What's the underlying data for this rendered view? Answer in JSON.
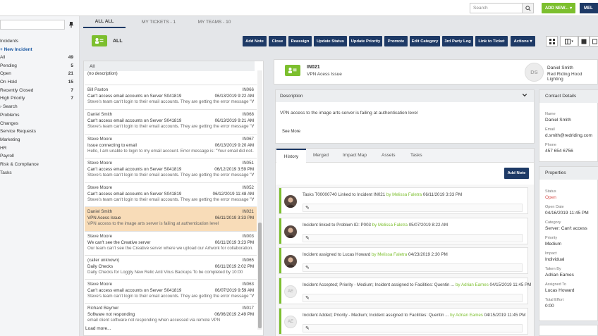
{
  "topbar": {
    "search_placeholder": "Search",
    "add_new": "ADD NEW...",
    "user": "MEL"
  },
  "sidebar": {
    "items": [
      {
        "label": "Incidents",
        "count": ""
      },
      {
        "label": "New Incident",
        "count": ""
      },
      {
        "label": "All",
        "count": "49"
      },
      {
        "label": "Pending",
        "count": "5"
      },
      {
        "label": "Open",
        "count": "21"
      },
      {
        "label": "On Hold",
        "count": "15"
      },
      {
        "label": "Recently Closed",
        "count": "7"
      },
      {
        "label": "High Priority",
        "count": "7"
      },
      {
        "label": "Search",
        "count": ""
      },
      {
        "label": "Problems",
        "count": ""
      },
      {
        "label": "Changes",
        "count": ""
      },
      {
        "label": "Service Requests",
        "count": ""
      },
      {
        "label": "Marketing",
        "count": ""
      },
      {
        "label": "HR",
        "count": ""
      },
      {
        "label": "Payroll",
        "count": ""
      },
      {
        "label": "Risk & Compliance",
        "count": ""
      },
      {
        "label": "Tasks",
        "count": ""
      }
    ]
  },
  "tabs": {
    "all": "ALL ALL",
    "my_tickets": "MY TICKETS - 1",
    "my_teams": "MY TEAMS - 10"
  },
  "header": {
    "title": "ALL"
  },
  "actions": [
    "Add Note",
    "Close",
    "Reassign",
    "Update Status",
    "Update Priority",
    "Promote",
    "Edit Category",
    "3rd Party Log",
    "Link to Ticket",
    "Actions"
  ],
  "list": {
    "heading": "All",
    "load_more": "Load more...",
    "rows": [
      {
        "name": "(no subject)",
        "id": "",
        "subject": "(no description)",
        "date": "",
        "preview": ""
      },
      {
        "name": "Bill Paxton",
        "id": "IN066",
        "subject": "Can't access email accounts on Server S041819",
        "date": "06/13/2019 9:22 AM",
        "preview": "Steve's team can't login to their email accounts. They are getting the error message \"We"
      },
      {
        "name": "Daniel Smith",
        "id": "IN068",
        "subject": "Can't access email accounts on Server S041819",
        "date": "06/13/2019 9:21 AM",
        "preview": "Steve's team can't login to their email accounts. They are getting the error message \"We"
      },
      {
        "name": "Steve Moore",
        "id": "IN067",
        "subject": "Issue connecting to email",
        "date": "06/13/2019 9:20 AM",
        "preview": "Hello,  I am unable to login to my email account. Error message is: \"Your email did not..."
      },
      {
        "name": "Steve Moore",
        "id": "IN051",
        "subject": "Can't access email accounts on Server S041819",
        "date": "06/12/2019 3:59 PM",
        "preview": "Steve's team can't login to their email accounts. They are getting the error message \"We"
      },
      {
        "name": "Steve Moore",
        "id": "IN052",
        "subject": "Can't access email accounts on Server S041819",
        "date": "06/12/2019 11:48 AM",
        "preview": "Steve's team can't login to their email accounts. They are getting the error message \"We"
      },
      {
        "name": "Daniel Smith",
        "id": "IN021",
        "subject": "VPN Acess Issue",
        "date": "06/11/2019 3:33 PM",
        "preview": "VPN access to the image arts server is failing at authentication level"
      },
      {
        "name": "Steve Moore",
        "id": "IN003",
        "subject": "We can't see the Creative server",
        "date": "06/11/2019 3:23 PM",
        "preview": "Our team can't see the Creative server where we upload our Artwork for collaboration. ..."
      },
      {
        "name": "(caller unknown)",
        "id": "IN065",
        "subject": "Daily Checks",
        "date": "06/11/2019 2:02 PM",
        "preview": "Daily Checks for  Loggly New Relic Anti Virus Backups  To be completed by 10:00"
      },
      {
        "name": "Steve Moore",
        "id": "IN063",
        "subject": "Can't access email accounts on Server S041819",
        "date": "06/07/2019 9:59 AM",
        "preview": "Steve's team can't login to their email accounts. They are getting the error message \"We"
      },
      {
        "name": "Richard Beymer",
        "id": "IN017",
        "subject": "Software not responding",
        "date": "06/06/2019 2:49 PM",
        "preview": "email client software not responding when accessed via remote VPN"
      }
    ]
  },
  "detail": {
    "id": "IN021",
    "subject": "VPN Acess Issue",
    "avatar_initials": "DS",
    "requester": "Daniel Smith",
    "org": "Red Riding Hood Lighting",
    "description_title": "Description",
    "description": "VPN access to the image arts server is failing at authentication level",
    "see_more": "See More",
    "tabs": [
      "History",
      "Merged",
      "Impact Map",
      "Assets",
      "Tasks"
    ],
    "add_note": "Add Note",
    "history": [
      {
        "text": "Tasks T00000740 Linked to Incident IN021",
        "by": "by Melissa Faletra",
        "date": "06/11/2019 3:33 PM",
        "avatar": "photo",
        "bar": "#7cbf2e"
      },
      {
        "text": "Incident linked to Problem ID: P003",
        "by": "by Melissa Faletra",
        "date": "05/07/2019 8:22 AM",
        "avatar": "photo",
        "bar": "#7cbf2e"
      },
      {
        "text": "Incident assigned to Lucas Howard",
        "by": "by Melissa Faletra",
        "date": "04/23/2019 2:30 PM",
        "avatar": "photo",
        "bar": "#7cbf2e"
      },
      {
        "text": "Incident Accepted; Priority - Medium; Incident assigned to Facilities: Quentin ...",
        "by": "by Adrian Eames",
        "date": "04/15/2019 11:45 PM",
        "avatar": "AE",
        "bar": "#7cbf2e"
      },
      {
        "text": "Incident Added; Priority - Medium; Incident assigned to Facilities: Quentin ...",
        "by": "by Adrian Eames",
        "date": "04/15/2019 11:45 PM",
        "avatar": "AE",
        "bar": "#7cbf2e"
      }
    ]
  },
  "contact": {
    "title": "Contact Details",
    "name_label": "Name",
    "name": "Daniel Smith",
    "email_label": "Email",
    "email": "d.smith@redriding.com",
    "phone_label": "Phone",
    "phone": "457 654 6756"
  },
  "properties": {
    "title": "Properties",
    "status_label": "Status",
    "status": "Open",
    "open_date_label": "Open Date",
    "open_date": "04/16/2019 11:45 PM",
    "category_label": "Category",
    "category": "Server: Can't access",
    "priority_label": "Priority",
    "priority": "Medium",
    "impact_label": "Impact",
    "impact": "Individual",
    "taken_by_label": "Taken By",
    "taken_by": "Adrian Eames",
    "assigned_label": "Assigned To",
    "assigned": "Lucas Howard",
    "effort_label": "Total Effort",
    "effort": "0:00"
  },
  "colors": {
    "accent": "#1e3a66",
    "brand_green": "#7cbf2e",
    "selected_row": "#f8dcb8",
    "status_open": "#d9534f"
  }
}
